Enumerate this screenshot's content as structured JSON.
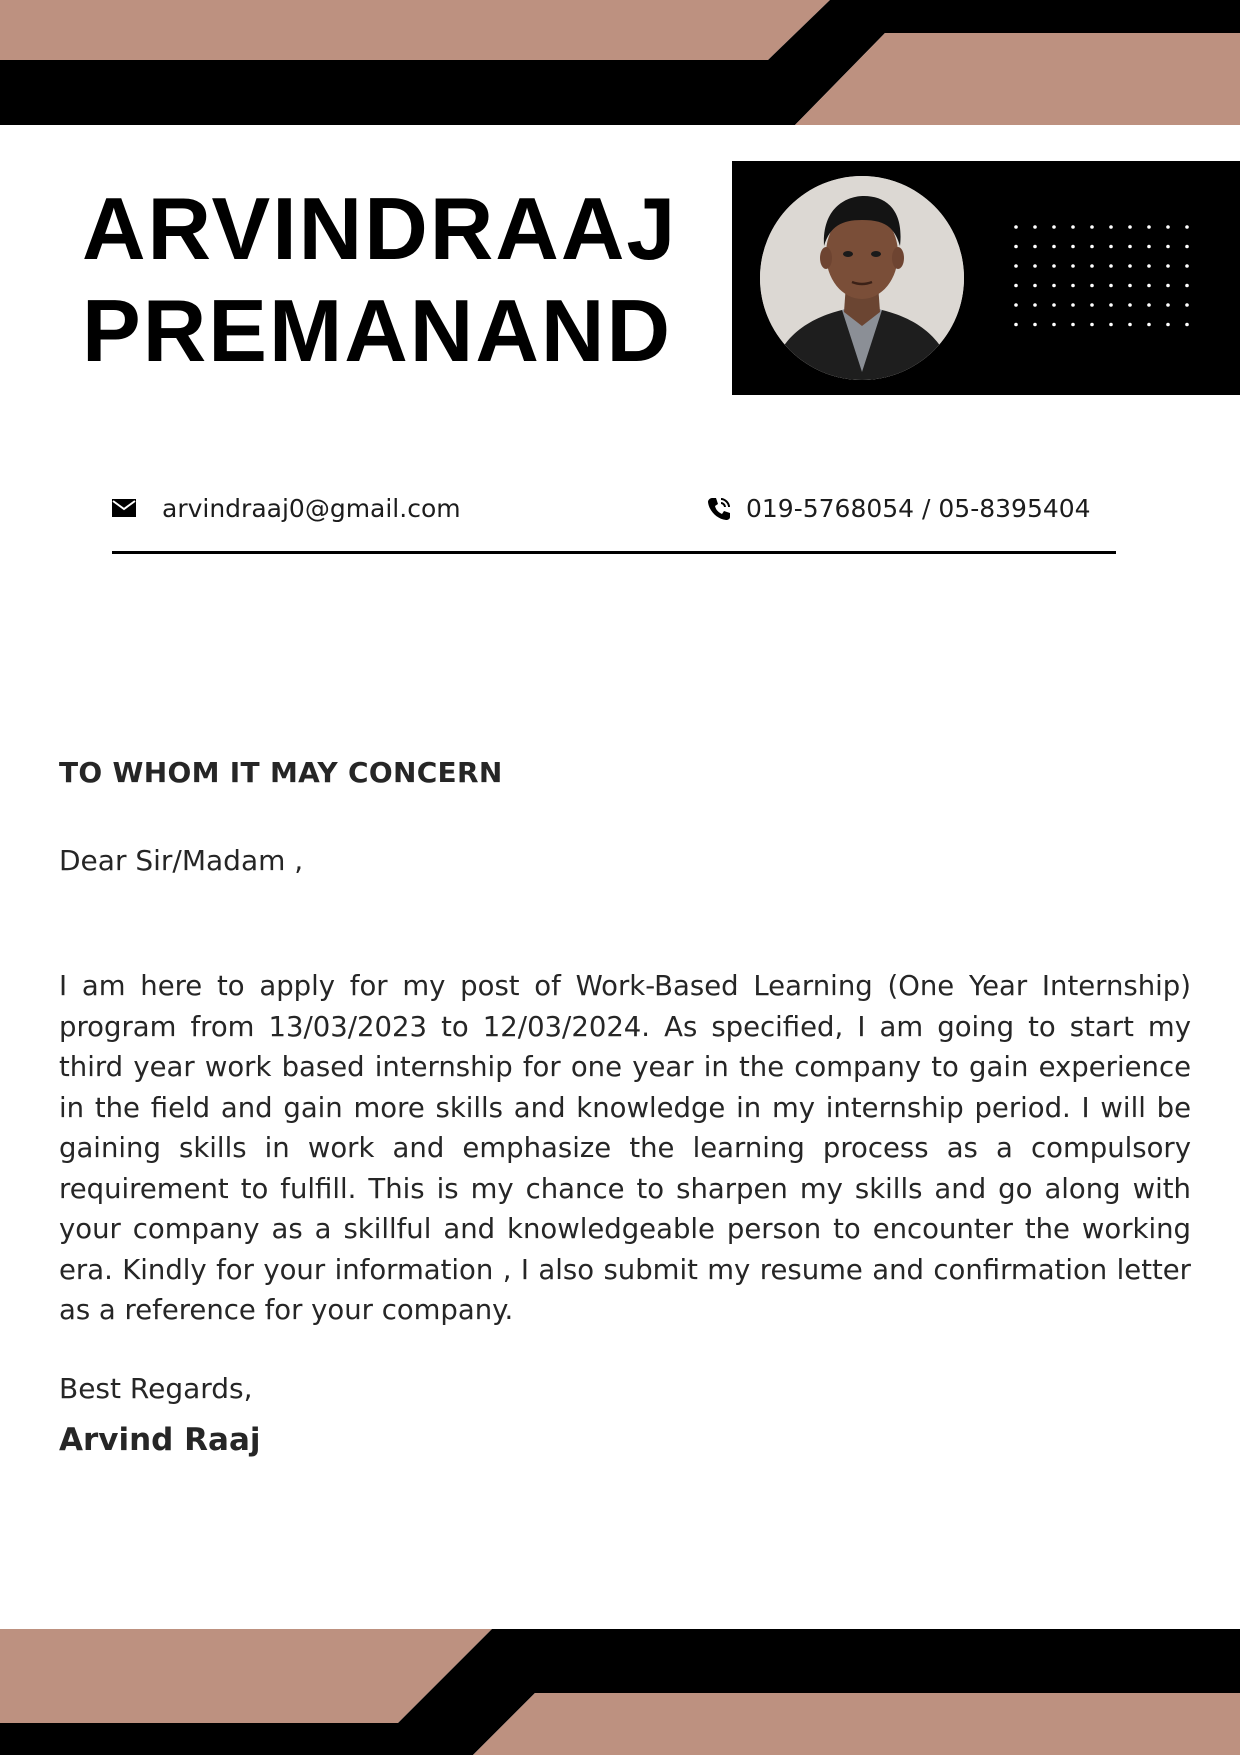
{
  "header": {
    "first_name": "ARVINDRAAJ",
    "last_name": "PREMANAND"
  },
  "contact": {
    "email_icon": "envelope-icon",
    "email": "arvindraaj0@gmail.com",
    "phone_icon": "phone-icon",
    "phone": "019-5768054 / 05-8395404"
  },
  "letter": {
    "heading": "TO WHOM IT MAY CONCERN",
    "salutation": "Dear Sir/Madam ,",
    "body": "I am here to apply for my post of Work-Based Learning (One Year Internship) program from 13/03/2023 to 12/03/2024. As specified, I am going to start my third year work based internship for one year in the company to gain experience in the field and gain more skills and knowledge in my internship period. I will be gaining skills in work and emphasize the learning process as a compulsory requirement to fulfill. This is my chance to sharpen my skills and go along with your company as a skillful and knowledgeable person to encounter the working era. Kindly for your information , I also submit my resume and confirmation letter as a reference for your company.",
    "closing": "Best Regards,",
    "signature": "Arvind Raaj"
  },
  "colors": {
    "accent": "#bd9180",
    "dark": "#000000",
    "text": "#262626"
  }
}
